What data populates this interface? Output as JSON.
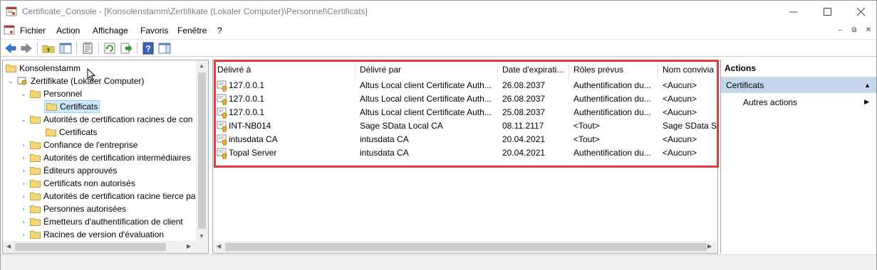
{
  "window": {
    "title": "Certificate_Console - [Konsolenstamm\\Zertifikate (Lokaler Computer)\\Personnel\\Certificats]"
  },
  "menu": {
    "items": [
      "Fichier",
      "Action",
      "Affichage",
      "Favoris",
      "Fenêtre",
      "?"
    ]
  },
  "toolbar": {
    "buttons": [
      "back-icon",
      "forward-icon",
      "up-folder-icon",
      "show-hide-tree-icon",
      "properties-icon",
      "refresh-icon",
      "export-list-icon",
      "help-icon",
      "show-hide-action-pane-icon"
    ]
  },
  "tree": {
    "root": "Konsolenstamm",
    "store": "Zertifikate (Lokaler Computer)",
    "items": [
      "Personnel",
      "Certificats",
      "Autorités de certification racines de con",
      "Certificats",
      "Confiance de l'entreprise",
      "Autorités de certification intermédiaires",
      "Éditeurs approuvés",
      "Certificats non autorisés",
      "Autorités de certification racine tierce pa",
      "Personnes autorisées",
      "Émetteurs d'authentification de client",
      "Racines de version d'évaluation"
    ]
  },
  "list": {
    "columns": [
      "Délivré à",
      "Délivré par",
      "Date d'expirati...",
      "Rôles prévus",
      "Nom convivia"
    ],
    "rows": [
      [
        "127.0.0.1",
        "Altus Local client Certificate Auth...",
        "26.08.2037",
        "Authentification du...",
        "<Aucun>"
      ],
      [
        "127.0.0.1",
        "Altus Local client Certificate Auth...",
        "26.08.2037",
        "Authentification du...",
        "<Aucun>"
      ],
      [
        "127.0.0.1",
        "Altus Local client Certificate Auth...",
        "25.08.2037",
        "Authentification du...",
        "<Aucun>"
      ],
      [
        "INT-NB014",
        "Sage SData Local CA",
        "08.11.2117",
        "<Tout>",
        "Sage SData Se"
      ],
      [
        "intusdata CA",
        "intusdata CA",
        "20.04.2021",
        "<Tout>",
        "<Aucun>"
      ],
      [
        "Topal Server",
        "intusdata CA",
        "20.04.2021",
        "Authentification du...",
        "<Aucun>"
      ]
    ]
  },
  "actions": {
    "title": "Actions",
    "section": "Certificats",
    "item": "Autres actions"
  },
  "colors": {
    "highlight": "#e03c3c",
    "selection": "#cce8ff",
    "actions_section_bg": "#c4d7ec"
  }
}
